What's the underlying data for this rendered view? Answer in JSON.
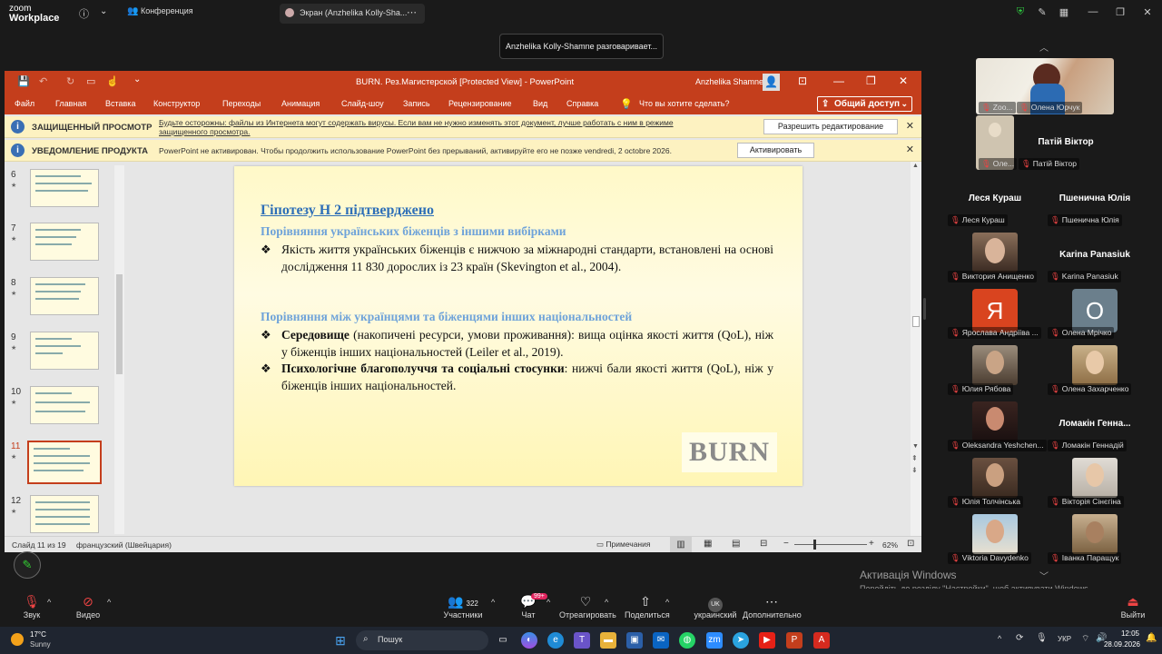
{
  "zoom": {
    "app_name_line1": "zoom",
    "app_name_line2": "Workplace",
    "meeting_label": "Конференция",
    "share_tab_label": "Экран (Anzhelika Kolly-Sha...",
    "speaking_toast": "Anzhelika Kolly-Shamne разговаривает..."
  },
  "ppt": {
    "window_title": "BURN. Рез.Магистерской [Protected View]  -  PowerPoint",
    "user_name": "Anzhelika Shamne",
    "menu": [
      "Файл",
      "Главная",
      "Вставка",
      "Конструктор",
      "Переходы",
      "Анимация",
      "Слайд-шоу",
      "Запись",
      "Рецензирование",
      "Вид",
      "Справка"
    ],
    "tell_me": "Что вы хотите сделать?",
    "share_label": "Общий доступ",
    "protected_bar": {
      "title": "ЗАЩИЩЕННЫЙ ПРОСМОТР",
      "message_line1": "Будьте осторожны: файлы из Интернета могут содержать вирусы. Если вам не нужно изменять этот документ, лучше работать с ним в режиме",
      "message_line2": "защищенного просмотра.",
      "button": "Разрешить редактирование"
    },
    "product_bar": {
      "title": "УВЕДОМЛЕНИЕ ПРОДУКТА",
      "message": "PowerPoint не активирован. Чтобы продолжить использование PowerPoint без прерываний, активируйте его не позже vendredi, 2 octobre 2026.",
      "button": "Активировать"
    },
    "thumbnails": [
      "6",
      "7",
      "8",
      "9",
      "10",
      "11",
      "12"
    ],
    "selected_thumbnail": "11",
    "slide": {
      "title": "Гіпотезу Н 2 підтверджено",
      "sub1": "Порівняння українських біженців з іншими вибірками",
      "bullet1": "Якість життя українських біженців є нижчою за міжнародні стандарти, встановлені на основі дослідження 11 830 дорослих із 23 країн (Skevington et al., 2004).",
      "sub2": "Порівняння між українцями та біженцями інших національностей",
      "bullet2_bold": "Середовище",
      "bullet2_rest": " (накопичені ресурси, умови проживання): вища оцінка якості життя (QoL), ніж у біженців інших національностей (Leiler et al., 2019).",
      "bullet3_bold": "Психологічне благополуччя та соціальні стосунки",
      "bullet3_rest": ": нижчі бали якості життя (QoL), ніж у біженців інших національностей.",
      "bullet_mark": "❖",
      "logo": "BURN"
    },
    "status": {
      "slide_counter": "Слайд 11 из 19",
      "language": "французский (Швейцария)",
      "notes": "Примечания",
      "zoom": "62%"
    }
  },
  "participants": {
    "top_video1": "Zoo...",
    "top_video1_name": "Олена Юрчук",
    "top_video2_small": "Оле...",
    "top_video2_name": "Патій Віктор",
    "patiy_header": "Патій Віктор",
    "lesya_header": "Леся  Кураш",
    "lesya_label": "Леся  Кураш",
    "pshen_header": "Пшенична Юлія",
    "pshen_label": "Пшенична Юлія",
    "anish_label": "Виктория Анищенко",
    "karina_header": "Karina Panasiuk",
    "karina_label": "Karina Panasiuk",
    "yaroslava_letter": "Я",
    "yaroslava_label": "Ярослава Андріїва ...",
    "mrichko_letter": "О",
    "mrichko_label": "Олена Мрічко",
    "ryabova_label": "Юлия Рябова",
    "zakharchenko_label": "Олена Захарченко",
    "yeshchen_label": "Oleksandra Yeshchen...",
    "lomakin_header": "Ломакін  Генна...",
    "lomakin_label": "Ломакін Геннадій",
    "tolchinska_label": "Юлія Толчінська",
    "sinegina_label": "Вікторія Сінєгіна",
    "davydenko_label": "Viktoria Davydenko",
    "paraschuk_label": "Іванка Паращук"
  },
  "activation": {
    "title": "Активація Windows",
    "subtitle": "Перейдіть до розділу \"Настройки\", щоб активувати Windows."
  },
  "bottom_bar": {
    "audio": "Звук",
    "video": "Видео",
    "participants_count": "322",
    "participants": "Участники",
    "chat_badge": "99+",
    "chat": "Чат",
    "react": "Отреагировать",
    "share": "Поделиться",
    "language_code": "UK",
    "language": "украинский",
    "more": "Дополнительно",
    "leave": "Выйти"
  },
  "taskbar": {
    "temperature": "17°C",
    "weather": "Sunny",
    "search": "Пошук",
    "keyboard_lang": "УКР",
    "time": "12:05",
    "date": "28.09.2026"
  }
}
